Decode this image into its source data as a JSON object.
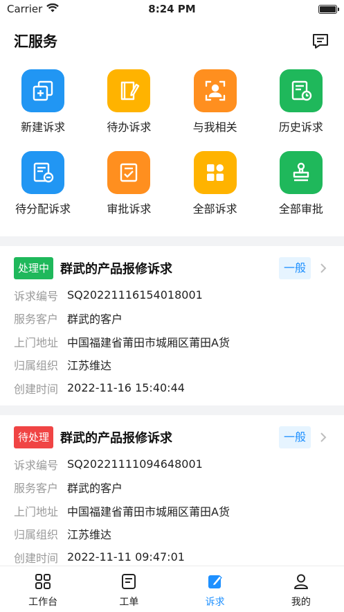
{
  "status_bar": {
    "carrier": "Carrier",
    "time": "8:24 PM"
  },
  "header": {
    "title": "汇服务",
    "message_icon": "message-icon"
  },
  "grid": [
    {
      "label": "新建诉求",
      "icon": "new-request-icon",
      "color": "#2196f3"
    },
    {
      "label": "待办诉求",
      "icon": "todo-request-icon",
      "color": "#ffb300"
    },
    {
      "label": "与我相关",
      "icon": "related-to-me-icon",
      "color": "#ff8f1f"
    },
    {
      "label": "历史诉求",
      "icon": "history-request-icon",
      "color": "#1fb85b"
    },
    {
      "label": "待分配诉求",
      "icon": "pending-assign-icon",
      "color": "#2196f3"
    },
    {
      "label": "审批诉求",
      "icon": "approval-request-icon",
      "color": "#ff8f1f"
    },
    {
      "label": "全部诉求",
      "icon": "all-requests-icon",
      "color": "#ffb300"
    },
    {
      "label": "全部审批",
      "icon": "all-approvals-icon",
      "color": "#1fb85b"
    }
  ],
  "cards": [
    {
      "status": "处理中",
      "status_color": "#1fb85b",
      "title": "群武的产品报修诉求",
      "level": "一般",
      "rows": [
        {
          "key": "诉求编号",
          "value": "SQ20221116154018001"
        },
        {
          "key": "服务客户",
          "value": "群武的客户"
        },
        {
          "key": "上门地址",
          "value": "中国福建省莆田市城厢区莆田A货"
        },
        {
          "key": "归属组织",
          "value": "江苏维达"
        },
        {
          "key": "创建时间",
          "value": "2022-11-16 15:40:44"
        }
      ]
    },
    {
      "status": "待处理",
      "status_color": "#f04444",
      "title": "群武的产品报修诉求",
      "level": "一般",
      "rows": [
        {
          "key": "诉求编号",
          "value": "SQ20221111094648001"
        },
        {
          "key": "服务客户",
          "value": "群武的客户"
        },
        {
          "key": "上门地址",
          "value": "中国福建省莆田市城厢区莆田A货"
        },
        {
          "key": "归属组织",
          "value": "江苏维达"
        },
        {
          "key": "创建时间",
          "value": "2022-11-11 09:47:01"
        }
      ]
    }
  ],
  "tabbar": [
    {
      "label": "工作台",
      "icon": "workbench-icon",
      "active": false
    },
    {
      "label": "工单",
      "icon": "work-order-icon",
      "active": false
    },
    {
      "label": "诉求",
      "icon": "request-icon",
      "active": true
    },
    {
      "label": "我的",
      "icon": "profile-icon",
      "active": false
    }
  ],
  "colors": {
    "accent": "#1e90ff",
    "band": "#f2f3f5"
  }
}
